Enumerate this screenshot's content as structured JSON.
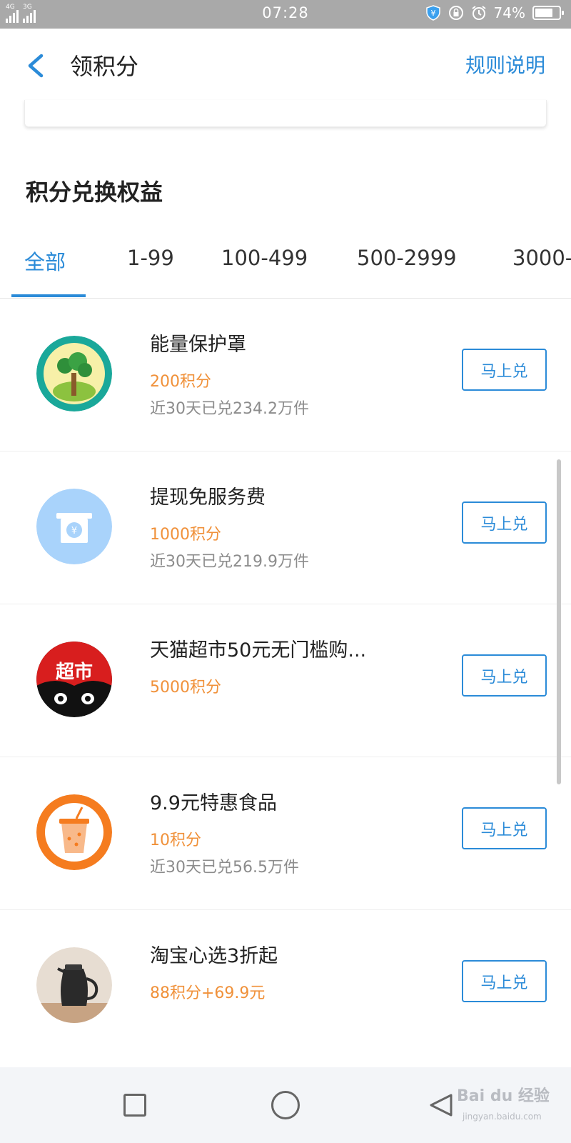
{
  "status_bar": {
    "network_1": "4G",
    "network_2": "3G",
    "time": "07:28",
    "battery_text": "74%",
    "battery_level": 0.74,
    "icons": [
      "alipay-shield-icon",
      "rotation-lock-icon",
      "alarm-icon",
      "battery-icon"
    ]
  },
  "header": {
    "title": "领积分",
    "rules_link": "规则说明",
    "back_icon": "chevron-left-icon"
  },
  "section_title": "积分兑换权益",
  "tabs": [
    {
      "label": "全部",
      "active": true
    },
    {
      "label": "1-99",
      "active": false
    },
    {
      "label": "100-499",
      "active": false
    },
    {
      "label": "500-2999",
      "active": false
    },
    {
      "label": "3000-",
      "active": false
    }
  ],
  "items": [
    {
      "name": "能量保护罩",
      "points": "200积分",
      "sold": "近30天已兑234.2万件",
      "button": "马上兑",
      "icon": "tree-icon"
    },
    {
      "name": "提现免服务费",
      "points": "1000积分",
      "sold": "近30天已兑219.9万件",
      "button": "马上兑",
      "icon": "atm-yuan-icon"
    },
    {
      "name": "天猫超市50元无门槛购...",
      "points": "5000积分",
      "sold": "",
      "button": "马上兑",
      "icon": "tmall-supermarket-icon",
      "badge_text": "超市"
    },
    {
      "name": "9.9元特惠食品",
      "points": "10积分",
      "sold": "近30天已兑56.5万件",
      "button": "马上兑",
      "icon": "drink-cup-icon"
    },
    {
      "name": "淘宝心选3折起",
      "points": "88积分+69.9元",
      "sold": "",
      "button": "马上兑",
      "icon": "kettle-icon"
    }
  ],
  "watermark": {
    "main": "Bai du 经验",
    "sub": "jingyan.baidu.com"
  },
  "colors": {
    "accent": "#2b8bd8",
    "points": "#f0913a",
    "muted": "#8c8c8c"
  }
}
